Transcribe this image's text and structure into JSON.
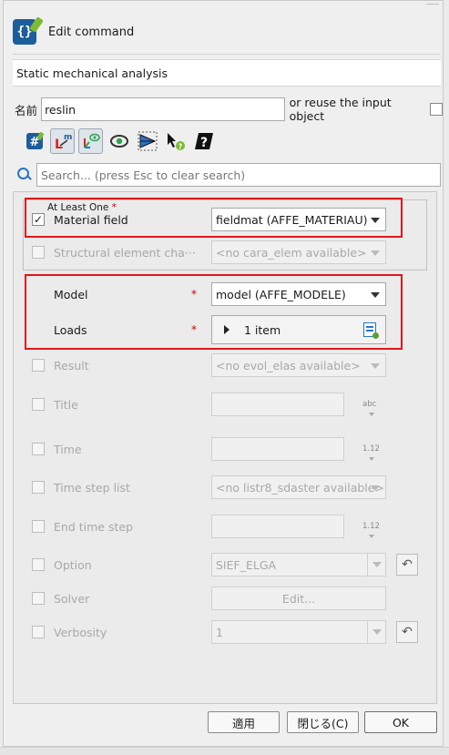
{
  "header": {
    "title": "Edit command"
  },
  "command_title": "Static mechanical analysis",
  "name_row": {
    "label": "名前",
    "value": "reslin",
    "reuse_label": "or reuse the input object"
  },
  "toolbar": {
    "buttons": [
      {
        "icon": "hash-icon",
        "active": false
      },
      {
        "icon": "mandatory-keywords-icon",
        "active": true
      },
      {
        "icon": "show-all-keywords-icon",
        "active": true
      },
      {
        "icon": "eye-icon",
        "active": false
      },
      {
        "icon": "mesh-view-icon",
        "active": false
      },
      {
        "icon": "whats-this-icon",
        "active": false
      },
      {
        "icon": "help-icon",
        "active": false
      }
    ]
  },
  "search": {
    "placeholder": "Search... (press Esc to clear search)",
    "value": ""
  },
  "group": {
    "label": "At Least One",
    "required_mark": "*"
  },
  "params": {
    "material_field": {
      "label": "Material field",
      "checked": true,
      "value": "fieldmat (AFFE_MATERIAU)"
    },
    "structural_element": {
      "label": "Structural element cha···",
      "checked": false,
      "value": "<no cara_elem available>"
    },
    "model": {
      "label": "Model",
      "required_mark": "*",
      "value": "model (AFFE_MODELE)"
    },
    "loads": {
      "label": "Loads",
      "required_mark": "*",
      "value": "1 item"
    },
    "result": {
      "label": "Result",
      "checked": false,
      "value": "<no evol_elas available>"
    },
    "title": {
      "label": "Title",
      "checked": false,
      "type": "abc"
    },
    "time": {
      "label": "Time",
      "checked": false,
      "type": "1.12"
    },
    "time_step_list": {
      "label": "Time step list",
      "checked": false,
      "value": "<no listr8_sdaster available>"
    },
    "end_time_step": {
      "label": "End time step",
      "checked": false,
      "type": "1.12"
    },
    "option": {
      "label": "Option",
      "checked": false,
      "value": "SIEF_ELGA"
    },
    "solver": {
      "label": "Solver",
      "checked": false,
      "button": "Edit..."
    },
    "verbosity": {
      "label": "Verbosity",
      "checked": false,
      "value": "1"
    }
  },
  "buttons": {
    "apply": "適用",
    "close": "閉じる(C)",
    "ok": "OK"
  },
  "colors": {
    "highlight": "#e0161b",
    "accent": "#2a73c8",
    "required": "#cc0000"
  }
}
